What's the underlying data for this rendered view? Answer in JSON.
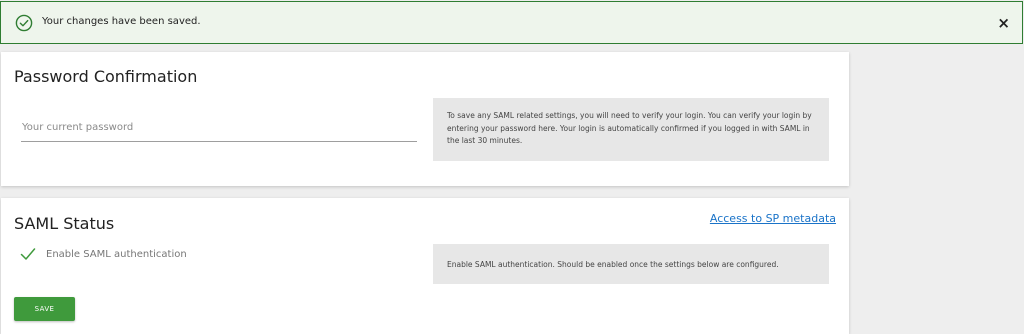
{
  "banner": {
    "message": "Your changes have been saved.",
    "close_label": "×",
    "icon": "check-circle-icon",
    "accent": "#2f7d32"
  },
  "password_card": {
    "title": "Password Confirmation",
    "input_placeholder": "Your current password",
    "input_value": "",
    "help_text": "To save any SAML related settings, you will need to verify your login. You can verify your login by entering your password here. Your login is automatically confirmed if you logged in with SAML in the last 30 minutes."
  },
  "saml_card": {
    "title": "SAML Status",
    "metadata_link": "Access to SP metadata",
    "enable_label": "Enable SAML authentication",
    "enable_checked": true,
    "help_text": "Enable SAML authentication. Should be enabled once the settings below are configured.",
    "save_label": "SAVE",
    "save_color": "#3f9a3c",
    "check_icon": "checkmark-icon"
  }
}
